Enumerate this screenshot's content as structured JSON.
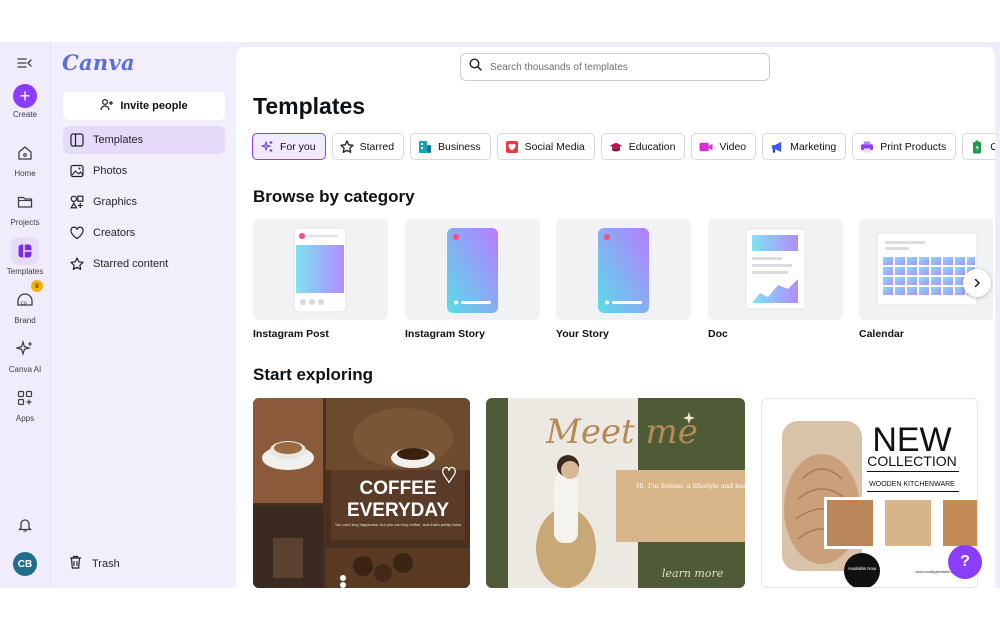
{
  "app": {
    "logo": "Canva"
  },
  "rail": {
    "items": [
      {
        "label": "Create",
        "icon": "plus-icon"
      },
      {
        "label": "Home",
        "icon": "home-icon"
      },
      {
        "label": "Projects",
        "icon": "folder-icon"
      },
      {
        "label": "Templates",
        "icon": "templates-icon",
        "active": true
      },
      {
        "label": "Brand",
        "icon": "brand-icon"
      },
      {
        "label": "Canva AI",
        "icon": "sparkles-icon"
      },
      {
        "label": "Apps",
        "icon": "apps-icon"
      }
    ],
    "avatar": "CB"
  },
  "panel": {
    "invite_label": "Invite people",
    "nav": [
      {
        "label": "Templates",
        "icon": "templates-icon",
        "active": true
      },
      {
        "label": "Photos",
        "icon": "photo-icon"
      },
      {
        "label": "Graphics",
        "icon": "shapes-icon"
      },
      {
        "label": "Creators",
        "icon": "heart-icon"
      },
      {
        "label": "Starred content",
        "icon": "star-icon"
      }
    ],
    "trash_label": "Trash"
  },
  "search": {
    "placeholder": "Search thousands of templates"
  },
  "main": {
    "title": "Templates",
    "tabs": [
      {
        "label": "For you",
        "icon": "sparkles-icon",
        "active": true
      },
      {
        "label": "Starred",
        "icon": "star-icon"
      },
      {
        "label": "Business",
        "icon": "business-icon"
      },
      {
        "label": "Social Media",
        "icon": "heart-icon"
      },
      {
        "label": "Education",
        "icon": "graduation-cap-icon"
      },
      {
        "label": "Video",
        "icon": "video-icon"
      },
      {
        "label": "Marketing",
        "icon": "megaphone-icon"
      },
      {
        "label": "Print Products",
        "icon": "printer-icon"
      },
      {
        "label": "Ot",
        "icon": "battery-icon"
      }
    ],
    "browse_title": "Browse by category",
    "categories": [
      {
        "label": "Instagram Post"
      },
      {
        "label": "Instagram Story"
      },
      {
        "label": "Your Story"
      },
      {
        "label": "Doc"
      },
      {
        "label": "Calendar"
      }
    ],
    "explore_title": "Start exploring",
    "cards": [
      {
        "headline_1": "COFFEE",
        "headline_2": "EVERYDAY",
        "subtext": "You can't buy happiness, but you can buy coffee, and that's pretty close"
      },
      {
        "script_title": "Meet me",
        "body": "Hi, I'm Selene, a lifestyle and beauty blogger. I write makeup tutorials and beauty reviews",
        "script_footer": "learn more"
      },
      {
        "headline_1": "NEW",
        "headline_2": "COLLECTION",
        "subtext": "WOODEN KITCHENWARE",
        "badge": "Available Now",
        "url": "www.reallygreatsite.com"
      }
    ]
  },
  "colors": {
    "accent": "#8b3dff",
    "sidebar_bg": "#f1ecfb",
    "active_bg": "#e6dcfa"
  }
}
